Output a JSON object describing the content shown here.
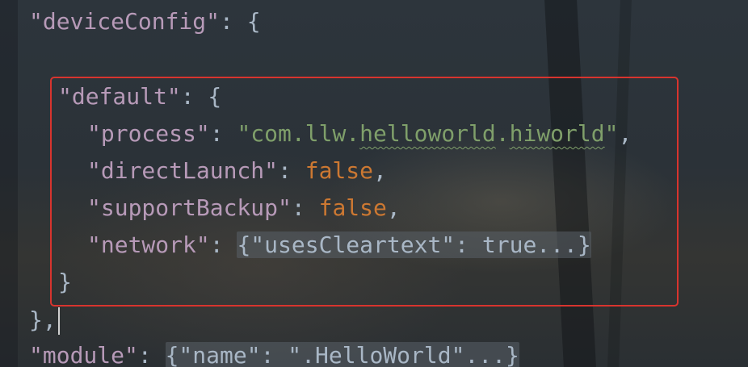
{
  "editor": {
    "lines": {
      "deviceConfig_key": "\"deviceConfig\"",
      "default_key": "\"default\"",
      "process_key": "\"process\"",
      "process_value_prefix": "\"com.",
      "process_value_llw": "llw",
      "process_value_dot1": ".",
      "process_value_helloworld": "helloworld",
      "process_value_dot2": ".",
      "process_value_hiworld": "hiworld",
      "process_value_suffix": "\"",
      "directLaunch_key": "\"directLaunch\"",
      "directLaunch_value": "false",
      "supportBackup_key": "\"supportBackup\"",
      "supportBackup_value": "false",
      "network_key": "\"network\"",
      "network_folded": "{\"usesCleartext\": true...}",
      "module_key": "\"module\"",
      "module_folded": "{\"name\": \".HelloWorld\"...}"
    },
    "punct": {
      "colon_brace": ": {",
      "colon": ": ",
      "comma": ",",
      "close_brace": "}",
      "close_brace_comma": "},"
    }
  },
  "colors": {
    "key": "#b79ab8",
    "string": "#7f9f6a",
    "keyword": "#cc7832",
    "highlight_border": "#d8342e"
  }
}
